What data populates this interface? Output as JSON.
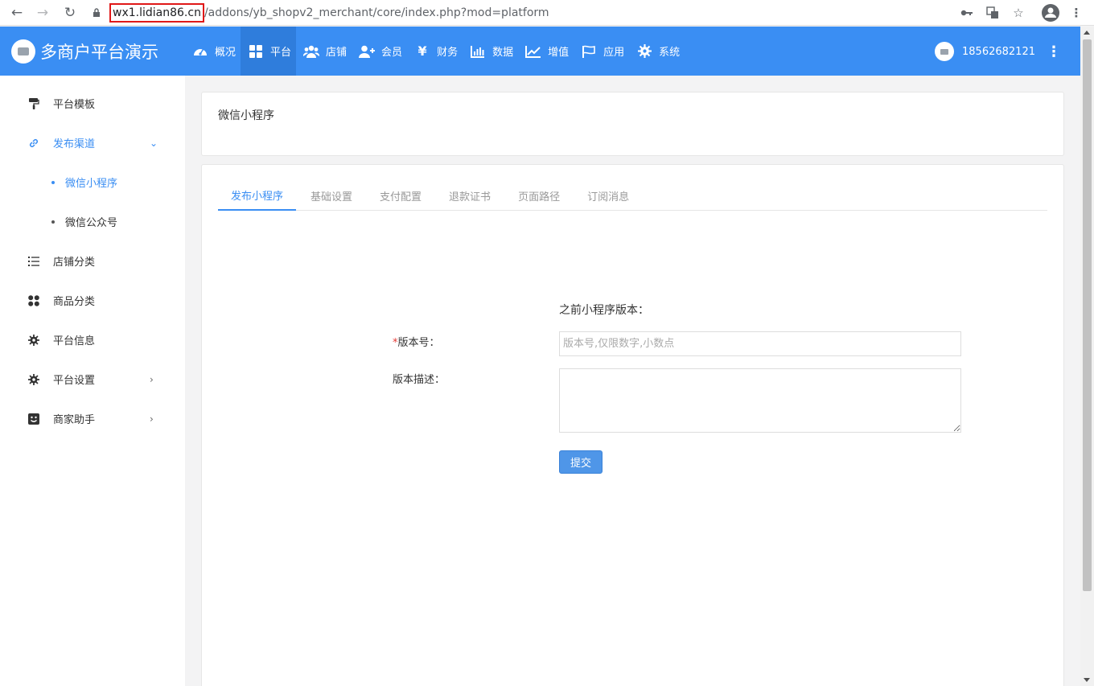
{
  "browser": {
    "url_host": "wx1.lidian86.cn",
    "url_path": "/addons/yb_shopv2_merchant/core/index.php?mod=platform"
  },
  "header": {
    "brand_title": "多商户平台演示",
    "nav": [
      {
        "label": "概况",
        "icon": "dashboard-icon"
      },
      {
        "label": "平台",
        "icon": "grid-icon"
      },
      {
        "label": "店铺",
        "icon": "users-icon"
      },
      {
        "label": "会员",
        "icon": "user-plus-icon"
      },
      {
        "label": "财务",
        "icon": "yen-icon"
      },
      {
        "label": "数据",
        "icon": "bar-chart-icon"
      },
      {
        "label": "增值",
        "icon": "line-chart-icon"
      },
      {
        "label": "应用",
        "icon": "flag-icon"
      },
      {
        "label": "系统",
        "icon": "gear-icon"
      }
    ],
    "username": "18562682121"
  },
  "sidebar": {
    "items": [
      {
        "label": "平台模板",
        "icon": "paint-roller-icon"
      },
      {
        "label": "发布渠道",
        "icon": "link-icon"
      },
      {
        "label": "微信小程序"
      },
      {
        "label": "微信公众号"
      },
      {
        "label": "店铺分类",
        "icon": "list-icon"
      },
      {
        "label": "商品分类",
        "icon": "apps-icon"
      },
      {
        "label": "平台信息",
        "icon": "gear-icon"
      },
      {
        "label": "平台设置",
        "icon": "gear-icon"
      },
      {
        "label": "商家助手",
        "icon": "smile-icon"
      }
    ]
  },
  "page": {
    "title": "微信小程序",
    "tabs": [
      "发布小程序",
      "基础设置",
      "支付配置",
      "退款证书",
      "页面路径",
      "订阅消息"
    ],
    "active_tab": "发布小程序"
  },
  "form": {
    "prev_version_label": "之前小程序版本：",
    "required_mark": "*",
    "version_label": "版本号：",
    "version_placeholder": "版本号,仅限数字,小数点",
    "version_value": "",
    "desc_label": "版本描述：",
    "desc_value": "",
    "submit_label": "提交"
  },
  "colors": {
    "primary": "#3a8ef3",
    "active_nav": "#2f7ddc",
    "required": "#e53935"
  }
}
